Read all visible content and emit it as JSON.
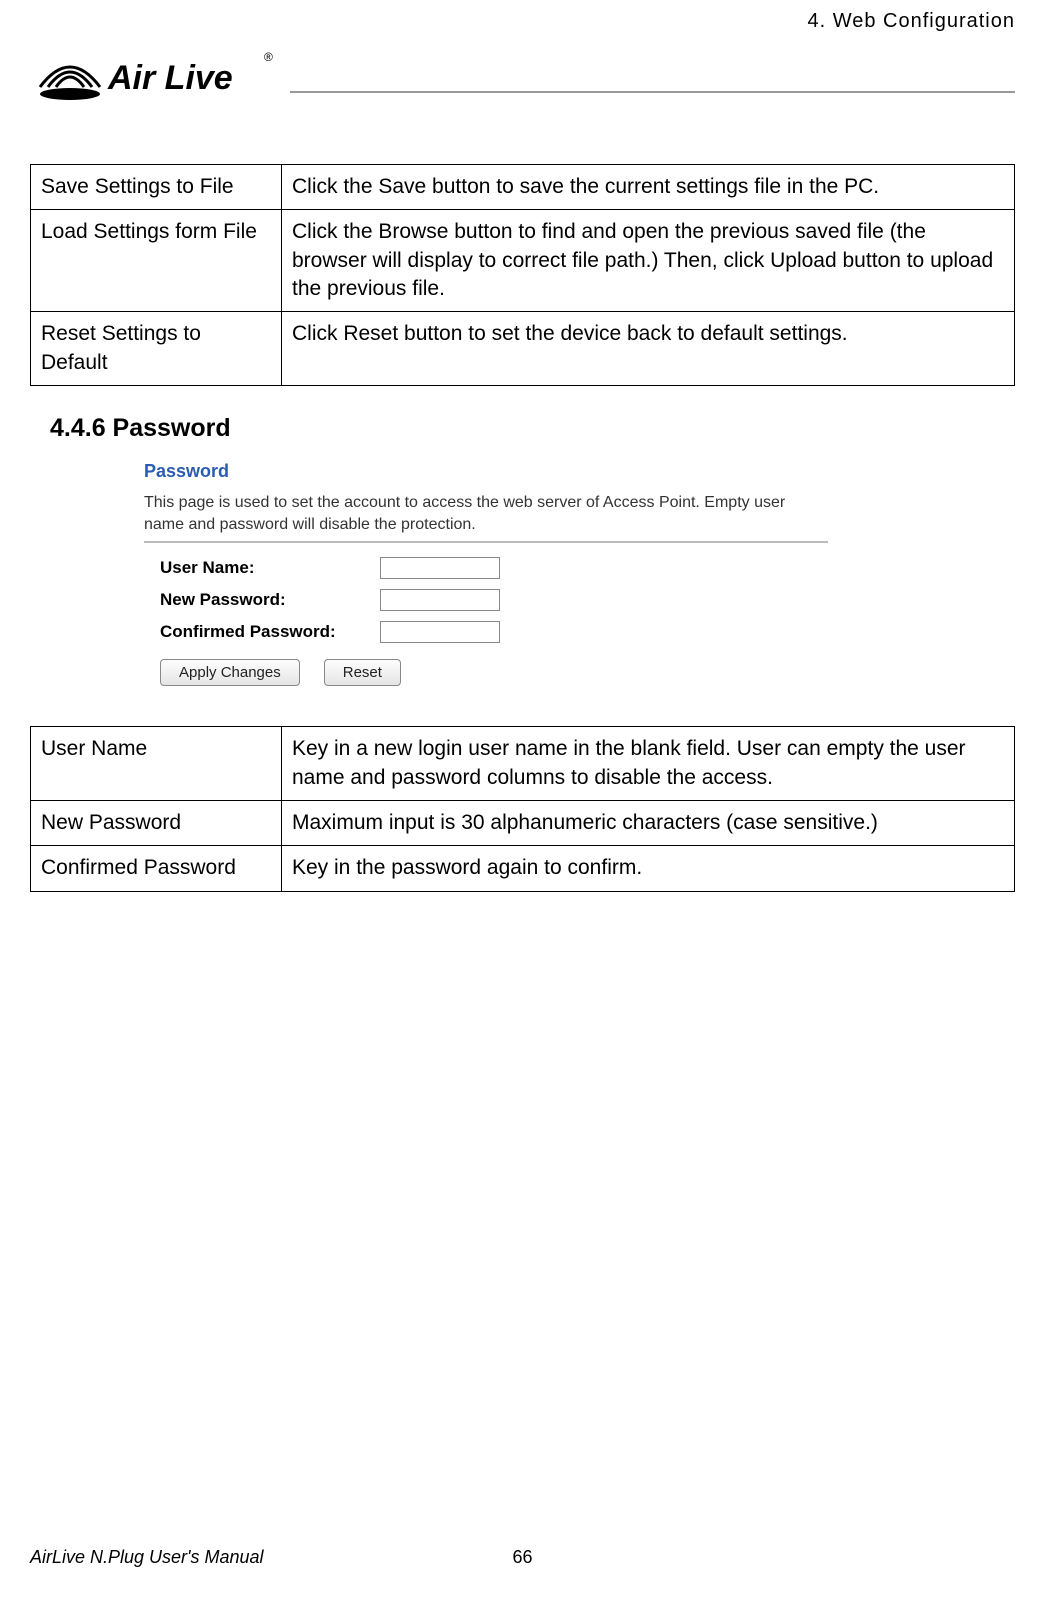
{
  "header": {
    "chapter": "4. Web Configuration",
    "logo_text": "Air Live",
    "logo_registered": "®"
  },
  "table1": {
    "rows": [
      {
        "name": "Save Settings to File",
        "desc": "Click the Save button to save the current settings file in the PC."
      },
      {
        "name": "Load Settings form File",
        "desc": "Click the Browse button to find and open the previous saved file (the browser will display to correct file path.) Then, click Upload button to upload the previous file."
      },
      {
        "name": "Reset Settings to Default",
        "desc": "Click Reset button to set the device back to default settings."
      }
    ]
  },
  "section_heading": "4.4.6 Password",
  "screenshot": {
    "title": "Password",
    "desc": "This page is used to set the account to access the web server of Access Point. Empty user name and password will disable the protection.",
    "fields": {
      "user_name_label": "User Name:",
      "new_password_label": "New Password:",
      "confirmed_password_label": "Confirmed Password:"
    },
    "buttons": {
      "apply": "Apply Changes",
      "reset": "Reset"
    }
  },
  "table2": {
    "rows": [
      {
        "name": "User Name",
        "desc": "Key in a new login user name in the blank field. User can empty the user name and password columns to disable the access."
      },
      {
        "name": "New Password",
        "desc": "Maximum input is 30 alphanumeric characters (case sensitive.)"
      },
      {
        "name": "Confirmed Password",
        "desc": "Key in the password again to confirm."
      }
    ]
  },
  "footer": {
    "title": "AirLive N.Plug User's Manual",
    "page": "66"
  }
}
